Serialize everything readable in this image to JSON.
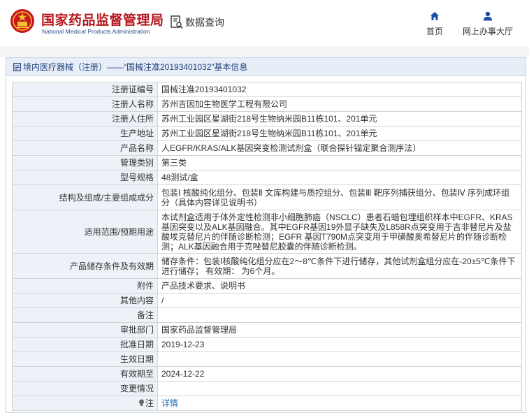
{
  "header": {
    "org_name": "国家药品监督管理局",
    "org_name_en": "National Medical Products Administration",
    "search_label": "数据查询",
    "nav": [
      {
        "label": "首页",
        "icon": "home-icon"
      },
      {
        "label": "网上办事大厅",
        "icon": "user-icon"
      }
    ]
  },
  "breadcrumb": "境内医疗器械（注册）——“国械注准20193401032”基本信息",
  "fields": [
    {
      "label": "注册证编号",
      "value": "国械注准20193401032"
    },
    {
      "label": "注册人名称",
      "value": "苏州吉因加生物医学工程有限公司"
    },
    {
      "label": "注册人住所",
      "value": "苏州工业园区星湖街218号生物纳米园B11栋101、201单元"
    },
    {
      "label": "生产地址",
      "value": "苏州工业园区星湖街218号生物纳米园B11栋101、201单元"
    },
    {
      "label": "产品名称",
      "value": "人EGFR/KRAS/ALK基因突变检测试剂盒（联合探针锚定聚合测序法）"
    },
    {
      "label": "管理类别",
      "value": "第三类"
    },
    {
      "label": "型号规格",
      "value": "48测试/盒"
    },
    {
      "label": "结构及组成/主要组成成分",
      "value": "包装Ⅰ 核酸纯化组分、包装Ⅱ 文库构建与质控组分、包装Ⅲ 靶序列捕获组分、包装Ⅳ 序列成环组分（具体内容详见说明书）"
    },
    {
      "label": "适用范围/预期用途",
      "value": "本试剂盒适用于体外定性检测非小细胞肺癌（NSCLC）患者石蜡包埋组织样本中EGFR、KRAS基因突变以及ALK基因融合。其中EGFR基因19外显子缺失及L858R点突变用于吉非替尼片及盐酸埃克替尼片的伴随诊断检测；EGFR 基因T790M点突变用于甲磺酸奥希替尼片的伴随诊断检测；ALK基因融合用于克唑替尼胶囊的伴随诊断检测。"
    },
    {
      "label": "产品储存条件及有效期",
      "value": "储存条件：包装Ⅰ核酸纯化组分应在2～8℃条件下进行储存，其他试剂盒组分应在-20±5℃条件下进行储存； 有效期： 为6个月。"
    },
    {
      "label": "附件",
      "value": "产品技术要求、说明书"
    },
    {
      "label": "其他内容",
      "value": "/"
    },
    {
      "label": "备注",
      "value": ""
    },
    {
      "label": "审批部门",
      "value": "国家药品监督管理局"
    },
    {
      "label": "批准日期",
      "value": "2019-12-23"
    },
    {
      "label": "生效日期",
      "value": ""
    },
    {
      "label": "有效期至",
      "value": "2024-12-22"
    },
    {
      "label": "变更情况",
      "value": ""
    },
    {
      "label": "注",
      "value": "详情",
      "icon": "bulb-icon"
    }
  ],
  "colors": {
    "brand_red": "#b5171d",
    "brand_blue": "#2a4a8a",
    "label_bg": "#eef2f8",
    "link": "#1565c0"
  }
}
